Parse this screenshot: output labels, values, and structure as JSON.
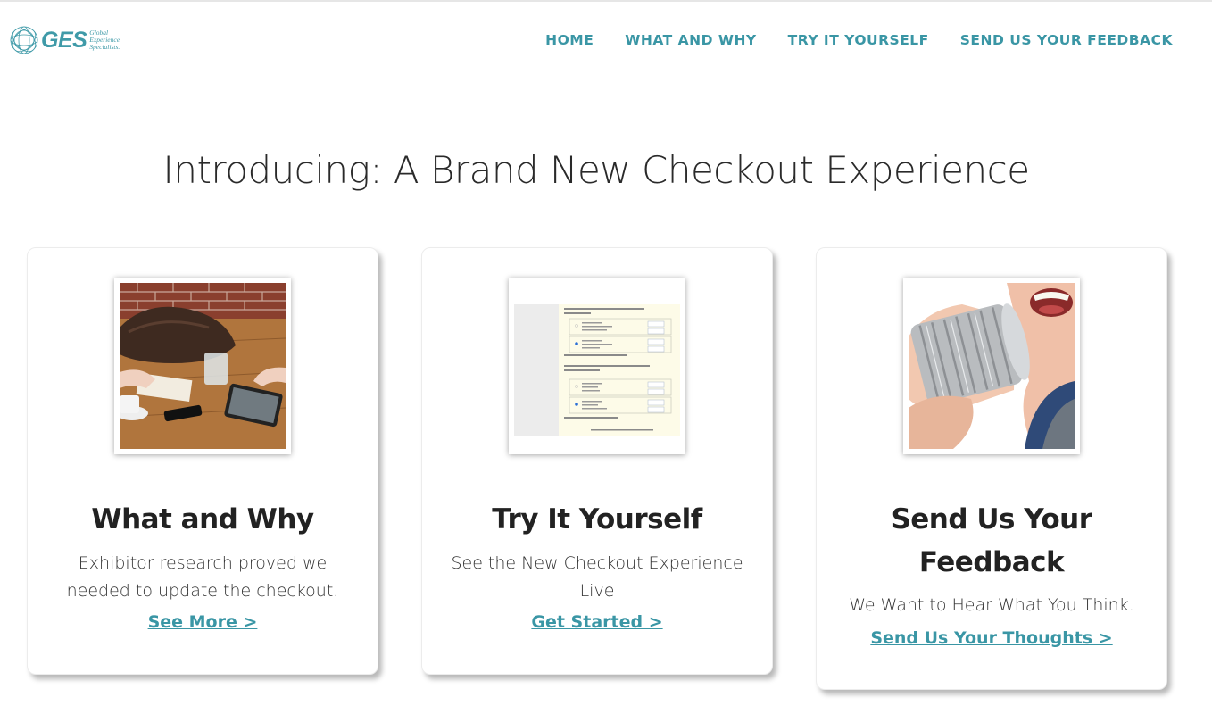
{
  "brand": {
    "logo_text": "GES",
    "tagline": [
      "Global",
      "Experience",
      "Specialists."
    ],
    "accent": "#3a96a5"
  },
  "nav": {
    "items": [
      {
        "label": "HOME"
      },
      {
        "label": "WHAT AND WHY"
      },
      {
        "label": "TRY IT YOURSELF"
      },
      {
        "label": "SEND US YOUR FEEDBACK"
      }
    ]
  },
  "hero": {
    "title": "Introducing: A Brand New Checkout Experience"
  },
  "cards": [
    {
      "title": "What and Why",
      "description": "Exhibitor research proved we needed to update the checkout.",
      "link": "See More >"
    },
    {
      "title": "Try It Yourself",
      "description": "See the New Checkout Experience Live",
      "link": "Get Started >"
    },
    {
      "title": "Send Us Your Feedback",
      "description": "We Want to Hear What You Think.",
      "link": "Send Us Your Thoughts >"
    }
  ]
}
